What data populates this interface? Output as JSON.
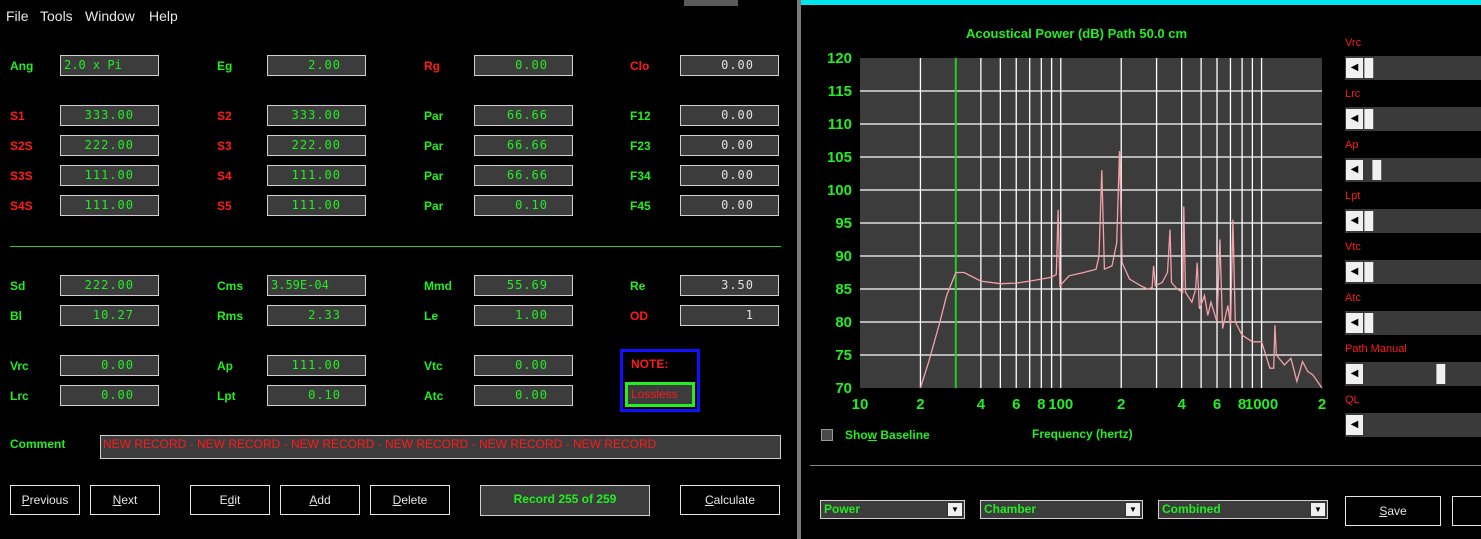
{
  "menu": {
    "file": "File",
    "tools": "Tools",
    "window": "Window",
    "help": "Help"
  },
  "params": {
    "ang": {
      "label": "Ang",
      "value": "2.0 x Pi"
    },
    "eg": {
      "label": "Eg",
      "value": "2.00"
    },
    "rg": {
      "label": "Rg",
      "value": "0.00"
    },
    "clo": {
      "label": "Clo",
      "value": "0.00"
    },
    "s1": {
      "label": "S1",
      "value": "333.00"
    },
    "s2": {
      "label": "S2",
      "value": "333.00"
    },
    "par1": {
      "label": "Par",
      "value": "66.66"
    },
    "f12": {
      "label": "F12",
      "value": "0.00"
    },
    "s2s": {
      "label": "S2S",
      "value": "222.00"
    },
    "s3": {
      "label": "S3",
      "value": "222.00"
    },
    "par2": {
      "label": "Par",
      "value": "66.66"
    },
    "f23": {
      "label": "F23",
      "value": "0.00"
    },
    "s3s": {
      "label": "S3S",
      "value": "111.00"
    },
    "s4": {
      "label": "S4",
      "value": "111.00"
    },
    "par3": {
      "label": "Par",
      "value": "66.66"
    },
    "f34": {
      "label": "F34",
      "value": "0.00"
    },
    "s4s": {
      "label": "S4S",
      "value": "111.00"
    },
    "s5": {
      "label": "S5",
      "value": "111.00"
    },
    "par4": {
      "label": "Par",
      "value": "0.10"
    },
    "f45": {
      "label": "F45",
      "value": "0.00"
    },
    "sd": {
      "label": "Sd",
      "value": "222.00"
    },
    "cms": {
      "label": "Cms",
      "value": "3.59E-04"
    },
    "mmd": {
      "label": "Mmd",
      "value": "55.69"
    },
    "re": {
      "label": "Re",
      "value": "3.50"
    },
    "bl": {
      "label": "Bl",
      "value": "10.27"
    },
    "rms": {
      "label": "Rms",
      "value": "2.33"
    },
    "le": {
      "label": "Le",
      "value": "1.00"
    },
    "od": {
      "label": "OD",
      "value": "1"
    },
    "vrc": {
      "label": "Vrc",
      "value": "0.00"
    },
    "ap": {
      "label": "Ap",
      "value": "111.00"
    },
    "vtc": {
      "label": "Vtc",
      "value": "0.00"
    },
    "lrc": {
      "label": "Lrc",
      "value": "0.00"
    },
    "lpt": {
      "label": "Lpt",
      "value": "0.10"
    },
    "atc": {
      "label": "Atc",
      "value": "0.00"
    }
  },
  "note": {
    "label": "NOTE:",
    "value": "Lossless"
  },
  "comment": {
    "label": "Comment",
    "value": "NEW RECORD - NEW RECORD - NEW RECORD - NEW RECORD - NEW RECORD - NEW RECORD"
  },
  "buttons": {
    "previous": {
      "u": "P",
      "rest": "revious"
    },
    "next": {
      "u": "N",
      "rest": "ext"
    },
    "edit": {
      "a": "E",
      "u": "d",
      "rest": "it"
    },
    "add": {
      "u": "A",
      "rest": "dd"
    },
    "delete": {
      "u": "D",
      "rest": "elete"
    },
    "calculate": {
      "u": "C",
      "rest": "alculate"
    },
    "save": {
      "u": "S",
      "rest": "ave"
    }
  },
  "record_status": "Record 255 of 259",
  "chart_title": "Acoustical Power (dB)   Path 50.0 cm",
  "show_baseline": {
    "u": "Show",
    "a": "Sho",
    "w": "w",
    "rest": " Baseline"
  },
  "sliders": {
    "vrc": {
      "label": "Vrc",
      "position": 0.0
    },
    "lrc": {
      "label": "Lrc",
      "position": 0.0
    },
    "ap": {
      "label": "Ap",
      "position": 0.08
    },
    "lpt": {
      "label": "Lpt",
      "position": 0.0
    },
    "vtc": {
      "label": "Vtc",
      "position": 0.0
    },
    "atc": {
      "label": "Atc",
      "position": 0.0
    },
    "path": {
      "label": "Path  Manual",
      "position": 0.72
    },
    "ql": {
      "label": "QL",
      "position": null
    }
  },
  "dropdowns": {
    "power": "Power",
    "chamber": "Chamber",
    "combined": "Combined"
  },
  "colors": {
    "green": "#22ee22",
    "red": "#ff1a1a",
    "curve": "#f4a0a8",
    "grid": "#ffffff",
    "plot_bg": "#3c3c3c",
    "marker": "#22cc22"
  },
  "chart_data": {
    "type": "line",
    "title": "Acoustical Power (dB)   Path 50.0 cm",
    "xlabel": "Frequency (hertz)",
    "ylabel": "",
    "x_scale": "log",
    "xlim": [
      10,
      2000
    ],
    "ylim": [
      70,
      120
    ],
    "y_ticks": [
      "120",
      "115",
      "110",
      "105",
      "100",
      "95",
      "90",
      "85",
      "80",
      "75",
      "70"
    ],
    "x_ticks": [
      "10",
      "2",
      "4",
      "6",
      "8",
      "100",
      "2",
      "4",
      "6",
      "8",
      "1000",
      "2"
    ],
    "marker_x": 30,
    "grid": true,
    "series": [
      {
        "values": [
          [
            20,
            70
          ],
          [
            22,
            74
          ],
          [
            25,
            80
          ],
          [
            27,
            84
          ],
          [
            30,
            87.5
          ],
          [
            33,
            87.5
          ],
          [
            40,
            86.2
          ],
          [
            50,
            85.8
          ],
          [
            60,
            85.9
          ],
          [
            70,
            86.2
          ],
          [
            80,
            86.5
          ],
          [
            90,
            86.8
          ],
          [
            95,
            87.2
          ],
          [
            97,
            97
          ],
          [
            99,
            85.5
          ],
          [
            110,
            87.0
          ],
          [
            130,
            87.5
          ],
          [
            150,
            88.0
          ],
          [
            155,
            90
          ],
          [
            160,
            103
          ],
          [
            165,
            88
          ],
          [
            180,
            88.5
          ],
          [
            190,
            92
          ],
          [
            196,
            105.9
          ],
          [
            202,
            89
          ],
          [
            220,
            86.5
          ],
          [
            250,
            85.5
          ],
          [
            270,
            85
          ],
          [
            285,
            85.2
          ],
          [
            290,
            88.5
          ],
          [
            296,
            85.5
          ],
          [
            320,
            86
          ],
          [
            340,
            87.5
          ],
          [
            350,
            94
          ],
          [
            356,
            86
          ],
          [
            380,
            85
          ],
          [
            405,
            84.5
          ],
          [
            410,
            97.5
          ],
          [
            418,
            84.5
          ],
          [
            450,
            83
          ],
          [
            470,
            85
          ],
          [
            478,
            89
          ],
          [
            490,
            82
          ],
          [
            520,
            84
          ],
          [
            540,
            81
          ],
          [
            560,
            83
          ],
          [
            600,
            80
          ],
          [
            620,
            92.5
          ],
          [
            640,
            79
          ],
          [
            680,
            82.5
          ],
          [
            700,
            79.5
          ],
          [
            720,
            95.5
          ],
          [
            740,
            80
          ],
          [
            800,
            78
          ],
          [
            900,
            77
          ],
          [
            1000,
            77
          ],
          [
            1100,
            73
          ],
          [
            1150,
            73
          ],
          [
            1165,
            79.5
          ],
          [
            1185,
            75
          ],
          [
            1300,
            73.5
          ],
          [
            1400,
            74.5
          ],
          [
            1500,
            71
          ],
          [
            1600,
            74
          ],
          [
            1700,
            72.5
          ],
          [
            1800,
            72
          ],
          [
            2000,
            70
          ]
        ]
      }
    ]
  }
}
